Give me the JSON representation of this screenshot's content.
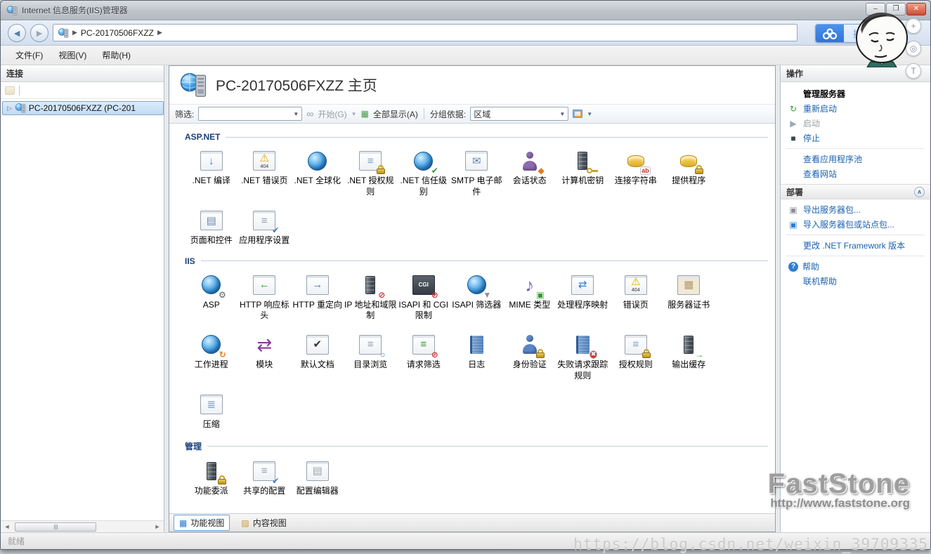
{
  "window": {
    "title": "Internet 信息服务(IIS)管理器",
    "controls": {
      "minimize": "–",
      "maximize": "❐",
      "close": "✕"
    }
  },
  "address_bar": {
    "path": "PC-20170506FXZZ",
    "drag_label": "拖拽"
  },
  "menu": [
    {
      "id": "file",
      "label": "文件(F)"
    },
    {
      "id": "view",
      "label": "视图(V)"
    },
    {
      "id": "help",
      "label": "帮助(H)"
    }
  ],
  "connections": {
    "title": "连接",
    "tree_item": "PC-20170506FXZZ (PC-201"
  },
  "main": {
    "title": "PC-20170506FXZZ 主页",
    "filter": {
      "label": "筛选:",
      "start": "开始(G)",
      "show_all": "全部显示(A)",
      "group_by_label": "分组依据:",
      "group_by_value": "区域"
    },
    "groups": [
      {
        "id": "aspnet",
        "name": "ASP.NET",
        "items": [
          {
            "label": ".NET 编译",
            "icon": "net-compilation-icon",
            "frame": true,
            "g": "↓",
            "c": "#2e7ed5"
          },
          {
            "label": ".NET 错误页",
            "icon": "net-error-pages-icon",
            "frame": true,
            "g": "⚠",
            "c": "#e8a200",
            "badge": "404"
          },
          {
            "label": ".NET 全球化",
            "icon": "net-globalization-icon",
            "shape": "globe"
          },
          {
            "label": ".NET 授权规则",
            "icon": "net-authorization-rules-icon",
            "frame": true,
            "g": "≡",
            "c": "#7aa0c8",
            "accent": {
              "type": "lock"
            }
          },
          {
            "label": ".NET 信任级别",
            "icon": "net-trust-levels-icon",
            "shape": "globe",
            "accent": {
              "g": "✔",
              "c": "#2da02d"
            }
          },
          {
            "label": "SMTP 电子邮件",
            "icon": "smtp-email-icon",
            "frame": true,
            "g": "✉",
            "c": "#5b87b8"
          },
          {
            "label": "会话状态",
            "icon": "session-state-icon",
            "shape": "person",
            "c": "#8e6bb0",
            "accent": {
              "g": "◆",
              "c": "#e07b20"
            }
          },
          {
            "label": "计算机密钥",
            "icon": "machine-key-icon",
            "shape": "server",
            "accent": {
              "type": "key"
            }
          },
          {
            "label": "连接字符串",
            "icon": "connection-strings-icon",
            "shape": "db",
            "accent": {
              "g": "ab",
              "c": "#c03030",
              "bg": "#ffffff"
            }
          },
          {
            "label": "提供程序",
            "icon": "providers-icon",
            "shape": "db",
            "accent": {
              "type": "lock"
            }
          },
          {
            "label": "页面和控件",
            "icon": "pages-and-controls-icon",
            "frame": true,
            "g": "▤",
            "c": "#6c87a8"
          },
          {
            "label": "应用程序设置",
            "icon": "application-settings-icon",
            "frame": true,
            "g": "≡",
            "c": "#98a2ae",
            "accent": {
              "g": "✔",
              "c": "#2e7ed5"
            }
          }
        ]
      },
      {
        "id": "iis",
        "name": "IIS",
        "items": [
          {
            "label": "ASP",
            "icon": "asp-icon",
            "shape": "globe",
            "accent": {
              "g": "⚙",
              "c": "#5a6068"
            }
          },
          {
            "label": "HTTP 响应标头",
            "icon": "http-response-headers-icon",
            "frame": true,
            "g": "←",
            "c": "#2da02d"
          },
          {
            "label": "HTTP 重定向",
            "icon": "http-redirect-icon",
            "frame": true,
            "g": "→",
            "c": "#2e7ed5"
          },
          {
            "label": "IP 地址和域限制",
            "icon": "ip-address-and-domain-restrictions-icon",
            "shape": "server",
            "accent": {
              "g": "⊘",
              "c": "#d33030"
            }
          },
          {
            "label": "ISAPI 和 CGI 限制",
            "icon": "isapi-and-cgi-restrictions-icon",
            "frame": true,
            "dark": true,
            "t": "CGI",
            "accent": {
              "g": "⊘",
              "c": "#d33030"
            }
          },
          {
            "label": "ISAPI 筛选器",
            "icon": "isapi-filters-icon",
            "shape": "globe",
            "accent": {
              "g": "▼",
              "c": "#8a8f98"
            }
          },
          {
            "label": "MIME 类型",
            "icon": "mime-types-icon",
            "g": "♪",
            "c": "#7a5cc0",
            "accent": {
              "g": "▣",
              "c": "#2da02d"
            }
          },
          {
            "label": "处理程序映射",
            "icon": "handler-mappings-icon",
            "frame": true,
            "g": "⇄",
            "c": "#2e7ed5"
          },
          {
            "label": "错误页",
            "icon": "error-pages-icon",
            "frame": true,
            "g": "⚠",
            "c": "#e8a200",
            "badge": "404"
          },
          {
            "label": "服务器证书",
            "icon": "server-certificates-icon",
            "frame": true,
            "fbg": "#f1e9d8",
            "g": "▦",
            "c": "#b09a6a"
          },
          {
            "label": "工作进程",
            "icon": "worker-processes-icon",
            "shape": "globe",
            "accent": {
              "g": "↻",
              "c": "#e07b20"
            }
          },
          {
            "label": "模块",
            "icon": "modules-icon",
            "g": "⇄",
            "c": "#8a3a9a"
          },
          {
            "label": "默认文档",
            "icon": "default-document-icon",
            "frame": true,
            "g": "✔",
            "c": "#333333"
          },
          {
            "label": "目录浏览",
            "icon": "directory-browsing-icon",
            "frame": true,
            "g": "≡",
            "c": "#98a2ae",
            "accent": {
              "g": "○",
              "c": "#2e7ed5"
            }
          },
          {
            "label": "请求筛选",
            "icon": "request-filtering-icon",
            "frame": true,
            "g": "≡",
            "c": "#2da02d",
            "accent": {
              "g": "⊘",
              "c": "#d33030"
            }
          },
          {
            "label": "日志",
            "icon": "logging-icon",
            "shape": "book"
          },
          {
            "label": "身份验证",
            "icon": "authentication-icon",
            "shape": "person",
            "c": "#5b87c8",
            "accent": {
              "type": "lock"
            }
          },
          {
            "label": "失败请求跟踪规则",
            "icon": "failed-request-tracing-rules-icon",
            "shape": "book",
            "accent": {
              "g": "✖",
              "c": "#ffffff",
              "bg": "#d33333",
              "round": true
            }
          },
          {
            "label": "授权规则",
            "icon": "authorization-rules-icon",
            "frame": true,
            "g": "≡",
            "c": "#7aa0c8",
            "accent": {
              "type": "lock"
            }
          },
          {
            "label": "输出缓存",
            "icon": "output-caching-icon",
            "shape": "server",
            "accent": {
              "g": "→",
              "c": "#2da02d"
            }
          },
          {
            "label": "压缩",
            "icon": "compression-icon",
            "frame": true,
            "g": "≣",
            "c": "#7aa0c8"
          }
        ]
      },
      {
        "id": "management",
        "name": "管理",
        "items": [
          {
            "label": "功能委派",
            "icon": "feature-delegation-icon",
            "shape": "server",
            "accent": {
              "type": "lock"
            }
          },
          {
            "label": "共享的配置",
            "icon": "shared-configuration-icon",
            "frame": true,
            "g": "≡",
            "c": "#98a2ae",
            "accent": {
              "g": "✔",
              "c": "#2e7ed5"
            }
          },
          {
            "label": "配置编辑器",
            "icon": "configuration-editor-icon",
            "frame": true,
            "g": "▤",
            "c": "#9aa4b0"
          }
        ]
      }
    ],
    "tabs": [
      {
        "name": "features-view",
        "label": "功能视图",
        "selected": true,
        "icon": "features-view-icon",
        "glyph": "▦",
        "color": "#2e7ed5"
      },
      {
        "name": "content-view",
        "label": "内容视图",
        "selected": false,
        "icon": "content-view-icon",
        "glyph": "▨",
        "color": "#c89a3a"
      }
    ]
  },
  "actions": {
    "title": "操作",
    "items": [
      {
        "name": "manage-server",
        "label": "管理服务器",
        "bold": true
      },
      {
        "name": "restart",
        "label": "重新启动",
        "icon": {
          "g": "↻",
          "c": "#2da02d"
        }
      },
      {
        "name": "start",
        "label": "启动",
        "disabled": true,
        "icon": {
          "g": "▶",
          "c": "#a0a6ac"
        }
      },
      {
        "name": "stop",
        "label": "停止",
        "icon": {
          "g": "■",
          "c": "#3f4750"
        }
      },
      {
        "sep": true
      },
      {
        "name": "view-application-pools",
        "label": "查看应用程序池",
        "indent": true
      },
      {
        "name": "view-websites",
        "label": "查看网站",
        "indent": true
      },
      {
        "header": "部署",
        "name": "deploy-section",
        "chevron": "∧"
      },
      {
        "name": "export-server-package",
        "label": "导出服务器包...",
        "icon": {
          "g": "▣",
          "c": "#8a8f98"
        }
      },
      {
        "name": "import-server-or-site-package",
        "label": "导入服务器包或站点包...",
        "icon": {
          "g": "▣",
          "c": "#2e7ed5"
        }
      },
      {
        "sep": true
      },
      {
        "name": "change-net-framework-version",
        "label": "更改 .NET Framework 版本",
        "indent": true
      },
      {
        "sep": true
      },
      {
        "name": "help",
        "label": "帮助",
        "icon": {
          "g": "?",
          "c": "#ffffff",
          "bg": "#2e7ed5",
          "round": true
        }
      },
      {
        "name": "online-help",
        "label": "联机帮助",
        "indent": true
      }
    ]
  },
  "status_bar": {
    "text": "就绪"
  },
  "overlay": {
    "buttons": [
      {
        "name": "overlay-plus-button",
        "glyph": "+"
      },
      {
        "name": "overlay-magnifier-button",
        "glyph": "◎"
      },
      {
        "name": "overlay-shirt-button",
        "glyph": "T"
      }
    ]
  },
  "watermarks": {
    "faststone": "FastStone",
    "faststone_url": "http://www.faststone.org",
    "csdn": "https://blog.csdn.net/weixin_39709335"
  }
}
